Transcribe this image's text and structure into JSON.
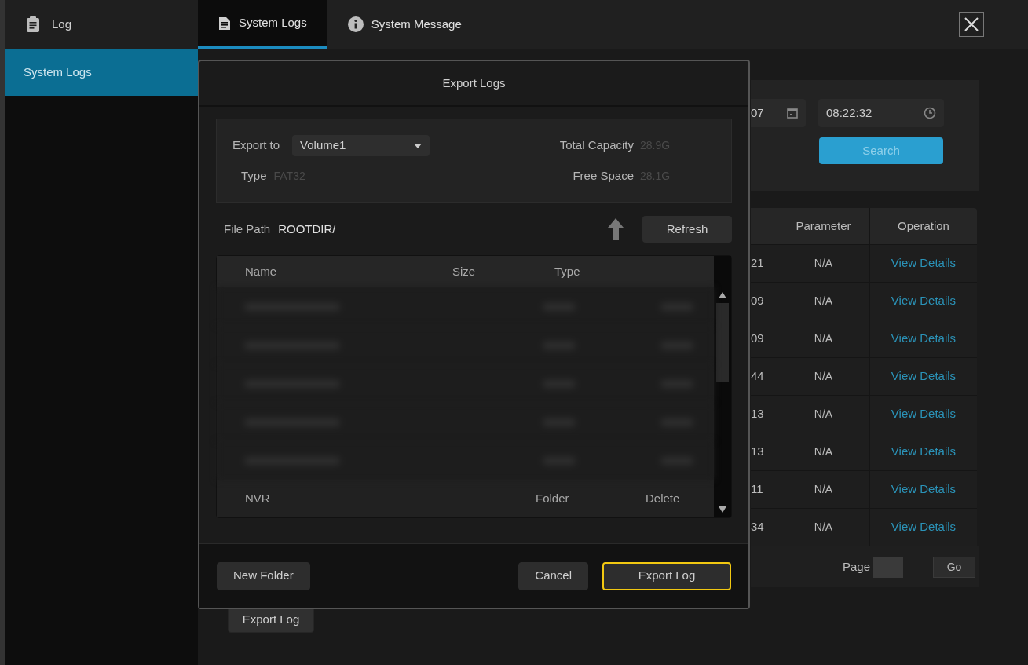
{
  "sidebar": {
    "title": "Log",
    "items": [
      {
        "label": "System Logs",
        "selected": true
      }
    ]
  },
  "tabs": [
    {
      "label": "System Logs",
      "selected": true,
      "kind": "document"
    },
    {
      "label": "System Message",
      "selected": false,
      "kind": "info"
    }
  ],
  "filter": {
    "date_partial": "07",
    "time": "08:22:32",
    "search_button": "Search"
  },
  "table": {
    "columns": [
      "Parameter",
      "Operation"
    ],
    "rows": [
      {
        "column_1": "21",
        "parameter": "N/A",
        "operation": "View Details"
      },
      {
        "column_1": "09",
        "parameter": "N/A",
        "operation": "View Details"
      },
      {
        "column_1": "09",
        "parameter": "N/A",
        "operation": "View Details"
      },
      {
        "column_1": "44",
        "parameter": "N/A",
        "operation": "View Details"
      },
      {
        "column_1": "13",
        "parameter": "N/A",
        "operation": "View Details"
      },
      {
        "column_1": "13",
        "parameter": "N/A",
        "operation": "View Details"
      },
      {
        "column_1": "11",
        "parameter": "N/A",
        "operation": "View Details"
      },
      {
        "column_1": "34",
        "parameter": "N/A",
        "operation": "View Details"
      }
    ]
  },
  "pagination": {
    "label": "Page",
    "go_button": "Go"
  },
  "export_button": "Export Log",
  "dialog": {
    "title": "Export Logs",
    "export_to_label": "Export to",
    "export_to": "Volume1",
    "type_label": "Type",
    "type": "FAT32",
    "total_capacity_label": "Total Capacity",
    "total_capacity": "28.9G",
    "free_space_label": "Free Space",
    "free_space": "28.1G",
    "file_path_label": "File Path",
    "file_path": "ROOTDIR/",
    "refresh_button": "Refresh",
    "columns": [
      "Name",
      "Size",
      "Type"
    ],
    "files": [
      {
        "kind": "blurred"
      },
      {
        "kind": "blurred"
      },
      {
        "kind": "blurred"
      },
      {
        "kind": "blurred"
      },
      {
        "kind": "blurred"
      },
      {
        "kind": "entry",
        "name": "NVR",
        "type": "Folder",
        "action": "Delete"
      }
    ],
    "buttons": [
      {
        "label": "New Folder",
        "focused": false
      },
      {
        "label": "Cancel",
        "focused": false
      },
      {
        "label": "Export Log",
        "focused": true
      }
    ]
  }
}
